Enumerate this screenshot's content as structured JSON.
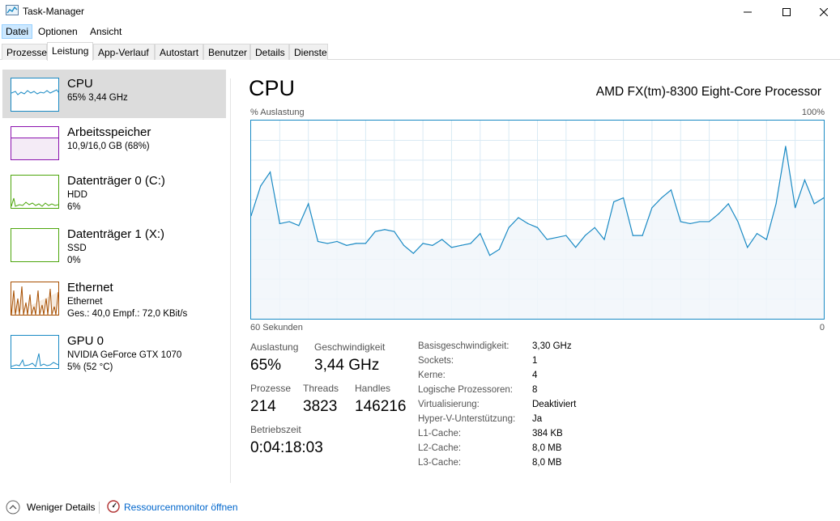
{
  "window": {
    "title": "Task-Manager"
  },
  "menu": [
    "Datei",
    "Optionen",
    "Ansicht"
  ],
  "tabs": [
    "Prozesse",
    "Leistung",
    "App-Verlauf",
    "Autostart",
    "Benutzer",
    "Details",
    "Dienste"
  ],
  "active_tab": "Leistung",
  "sidebar": {
    "items": [
      {
        "title": "CPU",
        "line1": "65% 3,44 GHz",
        "line2": "",
        "color": "#1a8ac4"
      },
      {
        "title": "Arbeitsspeicher",
        "line1": "10,9/16,0 GB (68%)",
        "line2": "",
        "color": "#8b12ae"
      },
      {
        "title": "Datenträger 0 (C:)",
        "line1": "HDD",
        "line2": "6%",
        "color": "#4da60c"
      },
      {
        "title": "Datenträger 1 (X:)",
        "line1": "SSD",
        "line2": "0%",
        "color": "#4da60c"
      },
      {
        "title": "Ethernet",
        "line1": "Ethernet",
        "line2": "Ges.: 40,0  Empf.: 72,0 KBit/s",
        "color": "#a74f01"
      },
      {
        "title": "GPU 0",
        "line1": "NVIDIA GeForce GTX 1070",
        "line2": "5% (52 °C)",
        "color": "#1a8ac4"
      }
    ]
  },
  "main": {
    "title": "CPU",
    "processor": "AMD FX(tm)-8300 Eight-Core Processor",
    "y_label": "% Auslastung",
    "y_max_label": "100%",
    "x_left_label": "60 Sekunden",
    "x_right_label": "0",
    "stats": {
      "utilization_label": "Auslastung",
      "utilization": "65%",
      "speed_label": "Geschwindigkeit",
      "speed": "3,44 GHz",
      "processes_label": "Prozesse",
      "processes": "214",
      "threads_label": "Threads",
      "threads": "3823",
      "handles_label": "Handles",
      "handles": "146216",
      "uptime_label": "Betriebszeit",
      "uptime": "0:04:18:03"
    },
    "details": [
      {
        "key": "Basisgeschwindigkeit:",
        "value": "3,30 GHz"
      },
      {
        "key": "Sockets:",
        "value": "1"
      },
      {
        "key": "Kerne:",
        "value": "4"
      },
      {
        "key": "Logische Prozessoren:",
        "value": "8"
      },
      {
        "key": "Virtualisierung:",
        "value": "Deaktiviert"
      },
      {
        "key": "Hyper-V-Unterstützung:",
        "value": "Ja"
      },
      {
        "key": "L1-Cache:",
        "value": "384 KB"
      },
      {
        "key": "L2-Cache:",
        "value": "8,0 MB"
      },
      {
        "key": "L3-Cache:",
        "value": "8,0 MB"
      }
    ]
  },
  "footer": {
    "less_details": "Weniger Details",
    "resource_monitor": "Ressourcenmonitor öffnen"
  },
  "chart_data": {
    "type": "area",
    "ylim": [
      0,
      100
    ],
    "x": [
      60,
      59,
      58,
      57,
      56,
      55,
      54,
      53,
      52,
      51,
      50,
      49,
      48,
      47,
      46,
      45,
      44,
      43,
      42,
      41,
      40,
      39,
      38,
      37,
      36,
      35,
      34,
      33,
      32,
      31,
      30,
      29,
      28,
      27,
      26,
      25,
      24,
      23,
      22,
      21,
      20,
      19,
      18,
      17,
      16,
      15,
      14,
      13,
      12,
      11,
      10,
      9,
      8,
      7,
      6,
      5,
      4,
      3,
      2,
      1,
      0
    ],
    "values": [
      52,
      67,
      74,
      48,
      49,
      47,
      58,
      39,
      38,
      39,
      37,
      38,
      38,
      44,
      45,
      44,
      37,
      33,
      38,
      37,
      40,
      36,
      37,
      38,
      43,
      32,
      35,
      46,
      51,
      48,
      46,
      40,
      41,
      42,
      36,
      42,
      46,
      40,
      59,
      61,
      42,
      42,
      56,
      61,
      65,
      49,
      48,
      49,
      49,
      53,
      58,
      49,
      36,
      43,
      40,
      58,
      87,
      56,
      70,
      58,
      61
    ],
    "color": "#1a8ac4",
    "fill": "#f1f6fa"
  }
}
